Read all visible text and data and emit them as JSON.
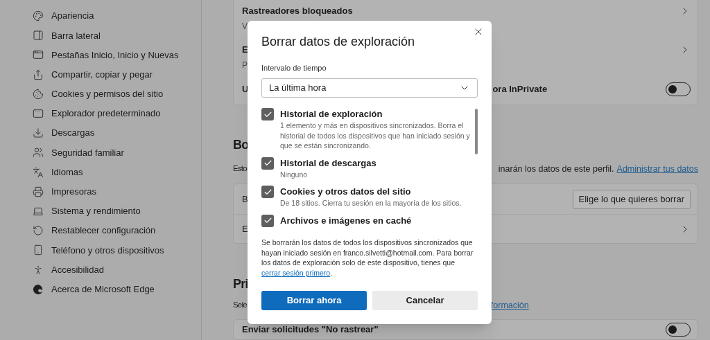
{
  "sidebar": {
    "items": [
      {
        "label": "Apariencia"
      },
      {
        "label": "Barra lateral"
      },
      {
        "label": "Pestañas Inicio, Inicio y Nuevas"
      },
      {
        "label": "Compartir, copiar y pegar"
      },
      {
        "label": "Cookies y permisos del sitio"
      },
      {
        "label": "Explorador predeterminado"
      },
      {
        "label": "Descargas"
      },
      {
        "label": "Seguridad familiar"
      },
      {
        "label": "Idiomas"
      },
      {
        "label": "Impresoras"
      },
      {
        "label": "Sistema y rendimiento"
      },
      {
        "label": "Restablecer configuración"
      },
      {
        "label": "Teléfono y otros dispositivos"
      },
      {
        "label": "Accesibilidad"
      },
      {
        "label": "Acerca de Microsoft Edge"
      }
    ]
  },
  "top_card": {
    "rows": [
      {
        "title": "Rastreadores bloqueados",
        "subtitle": "V",
        "kind": "link"
      },
      {
        "title": "E",
        "subtitle": "P",
        "kind": "link"
      },
      {
        "title": "U",
        "title_right": "ora InPrivate",
        "kind": "toggle",
        "on": false
      }
    ]
  },
  "section_1": {
    "heading": "Bo",
    "text_left": "Esto",
    "text_right": "inarán los datos de este perfil.",
    "link": "Administrar tus datos",
    "rows": [
      {
        "title": "B",
        "kind": "button",
        "button": "Elige lo que quieres borrar"
      },
      {
        "title": "E",
        "kind": "link"
      }
    ]
  },
  "section_2": {
    "heading": "Pri",
    "text_left": "Sele",
    "link": "formación",
    "rows": [
      {
        "title": "Enviar solicitudes \"No rastrear\"",
        "kind": "toggle",
        "on": false
      }
    ]
  },
  "dialog": {
    "title": "Borrar datos de exploración",
    "range_label": "Intervalo de tiempo",
    "range_value": "La última hora",
    "items": [
      {
        "title": "Historial de exploración",
        "description": "1 elemento y más en dispositivos sincronizados. Borra el historial de todos los dispositivos que han iniciado sesión y que se están sincronizando.",
        "checked": true
      },
      {
        "title": "Historial de descargas",
        "description": "Ninguno",
        "checked": true
      },
      {
        "title": "Cookies y otros datos del sitio",
        "description": "De 18 sitios. Cierra tu sesión en la mayoría de los sitios.",
        "checked": true
      },
      {
        "title": "Archivos e imágenes en caché",
        "checked": true
      }
    ],
    "info": "Se borrarán los datos de todos los dispositivos sincronizados que hayan iniciado sesión en franco.silvetti@hotmail.com. Para borrar los datos de exploración solo de este dispositivo, tienes que",
    "info_link": "cerrar sesión primero",
    "info_end": ".",
    "primary_button": "Borrar ahora",
    "secondary_button": "Cancelar"
  }
}
